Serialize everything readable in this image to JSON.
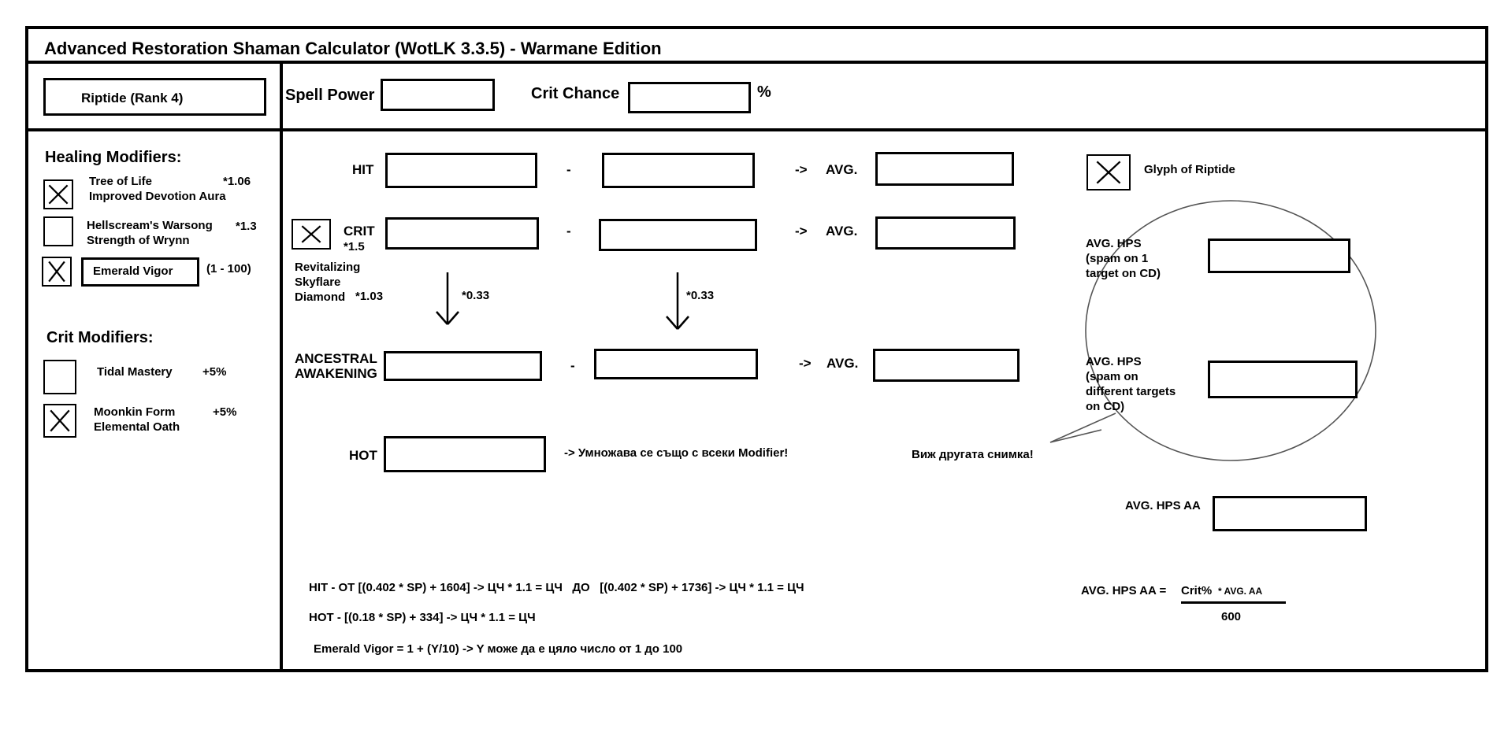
{
  "title": "Advanced Restoration Shaman Calculator (WotLK 3.3.5) - Warmane Edition",
  "spell_select": "Riptide (Rank 4)",
  "inputs": {
    "spell_power_label": "Spell Power",
    "spell_power_value": "",
    "crit_chance_label": "Crit Chance",
    "crit_chance_value": "",
    "crit_unit": "%"
  },
  "healing_modifiers": {
    "heading": "Healing Modifiers:",
    "items": [
      {
        "label1": "Tree of Life",
        "label2": "Improved Devotion Aura",
        "mult": "*1.06",
        "checked": true
      },
      {
        "label1": "Hellscream's Warsong",
        "label2": "Strength of Wrynn",
        "mult": "*1.3",
        "checked": false
      },
      {
        "label1": "Emerald Vigor",
        "range": "(1 - 100)",
        "checked": true
      }
    ]
  },
  "crit_modifiers": {
    "heading": "Crit Modifiers:",
    "items": [
      {
        "label1": "Tidal Mastery",
        "bonus": "+5%",
        "checked": false
      },
      {
        "label1": "Moonkin Form",
        "label2": "Elemental Oath",
        "bonus": "+5%",
        "checked": true
      }
    ]
  },
  "rows": {
    "hit_label": "HIT",
    "crit_label": "CRIT",
    "crit_mult": "*1.5",
    "crit_checked": true,
    "meta_gem": "Revitalizing Skyflare Diamond",
    "meta_mult": "*1.03",
    "ancestral_line1": "ANCESTRAL",
    "ancestral_line2": "AWAKENING",
    "hot_label": "HOT",
    "dash": "-",
    "arrow": "->",
    "avg_label": "AVG.",
    "factor": "*0.33",
    "hot_note": "-> Умножава се също с всеки Modifier!"
  },
  "glyph": {
    "label": "Glyph of Riptide",
    "checked": true
  },
  "hps": {
    "single_line1": "AVG. HPS",
    "single_line2": "(spam on 1",
    "single_line3": "target on CD)",
    "multi_line1": "AVG. HPS",
    "multi_line2": "(spam on",
    "multi_line3": "different targets",
    "multi_line4": "on CD)",
    "callout": "Виж другата снимка!",
    "aa_label": "AVG. HPS AA"
  },
  "formulas": {
    "hit": "HIT - ОТ [(0.402 * SP) + 1604] -> ЦЧ * 1.1 = ЦЧ   ДО   [(0.402 * SP) + 1736] -> ЦЧ * 1.1 = ЦЧ",
    "hot": "HOT - [(0.18 * SP) + 334] -> ЦЧ * 1.1 = ЦЧ",
    "emerald": "Emerald Vigor = 1 + (Y/10) -> Y може да е цяло число от 1 до 100",
    "aa_lhs": "AVG. HPS AA =",
    "aa_num_a": "Crit%",
    "aa_num_b": "* AVG. AA",
    "aa_den": "600"
  }
}
